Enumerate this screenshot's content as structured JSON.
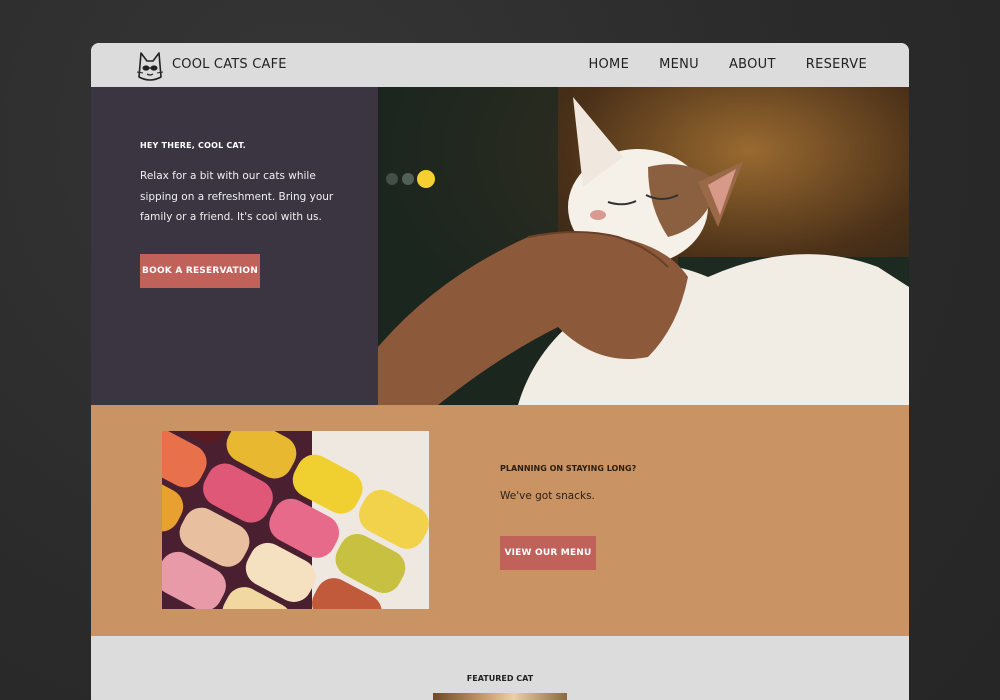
{
  "brand": {
    "name": "COOL CATS CAFE",
    "logo_icon": "cat-sunglasses-icon"
  },
  "nav": {
    "items": [
      {
        "label": "HOME"
      },
      {
        "label": "MENU"
      },
      {
        "label": "ABOUT"
      },
      {
        "label": "RESERVE"
      }
    ]
  },
  "hero": {
    "eyebrow": "HEY THERE, COOL CAT.",
    "text": "Relax for a bit with our cats while sipping on a refreshment. Bring your family or a friend. It's cool with us.",
    "button_label": "BOOK A RESERVATION",
    "image": "cat-being-petted-photo"
  },
  "snacks": {
    "eyebrow": "PLANNING ON STAYING LONG?",
    "text": "We've got snacks.",
    "button_label": "VIEW OUR MENU",
    "image": "macarons-photo"
  },
  "featured": {
    "title": "FEATURED CAT",
    "image": "featured-cat-photo"
  },
  "colors": {
    "hero_bg": "#3b3542",
    "snacks_bg": "#c99364",
    "button": "#c0615a",
    "nav_bg": "#dcdcdc"
  }
}
